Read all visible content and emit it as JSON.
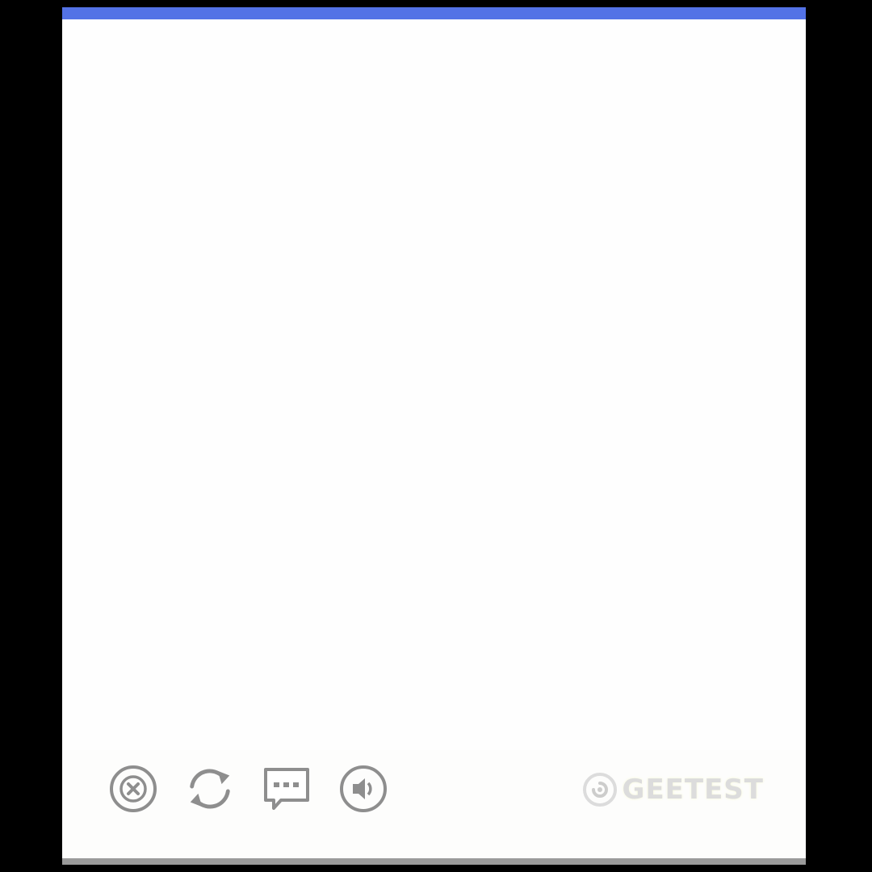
{
  "captcha": {
    "accent_color": "#5372e6",
    "panel_color": "#fdfdfc",
    "icon_color": "#8e8e8e",
    "toolbar": {
      "buttons": [
        {
          "name": "close",
          "icon": "close-circle-icon"
        },
        {
          "name": "refresh",
          "icon": "refresh-icon"
        },
        {
          "name": "feedback",
          "icon": "chat-bubble-icon"
        },
        {
          "name": "audio",
          "icon": "speaker-icon"
        }
      ]
    },
    "brand": {
      "name": "GEETEST",
      "logo_icon": "geetest-logo-icon"
    }
  }
}
